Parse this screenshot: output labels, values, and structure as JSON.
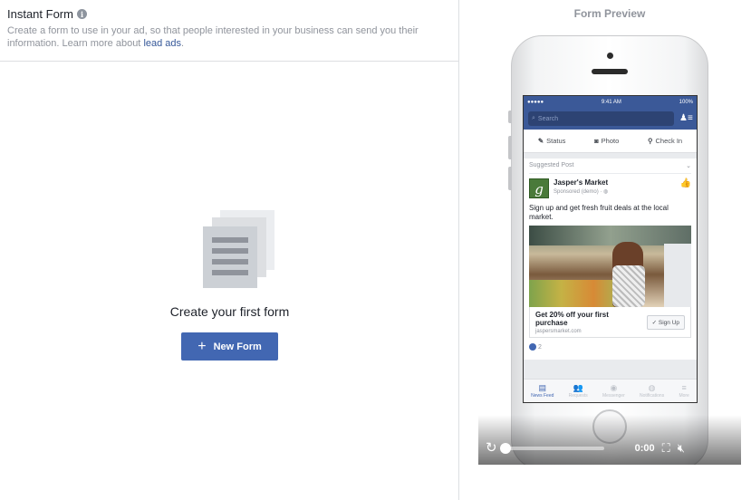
{
  "left_panel": {
    "title": "Instant Form",
    "info_glyph": "i",
    "description": "Create a form to use in your ad, so that people interested in your business can send you their information. Learn more about",
    "learn_more_link": "lead ads",
    "description_end": ".",
    "empty_state_title": "Create your first form",
    "new_form_button": "New Form",
    "new_form_icon": "plus-icon"
  },
  "right_panel": {
    "preview_title": "Form Preview",
    "phone": {
      "status": {
        "signal": "●●●●● ",
        "time": "9:41 AM",
        "battery": "100%"
      },
      "search_placeholder": "Search",
      "composer": [
        "Status",
        "Photo",
        "Check In"
      ],
      "post": {
        "suggested_label": "Suggested Post",
        "author": "Jasper's Market",
        "sponsored": "Sponsored (demo) · ",
        "logo_letter": "g",
        "text": "Sign up and get fresh fruit deals at the local market.",
        "cta_title": "Get 20% off your first purchase",
        "cta_url": "jaspersmarket.com",
        "cta_button": "Sign Up",
        "reaction_count": "2"
      },
      "tabs": [
        "News Feed",
        "Requests",
        "Messenger",
        "Notifications",
        "More"
      ]
    },
    "video": {
      "time": "0:00",
      "progress": 0
    }
  },
  "colors": {
    "brand_blue": "#4267b2",
    "facebook_header": "#3b5998",
    "link": "#365899"
  }
}
